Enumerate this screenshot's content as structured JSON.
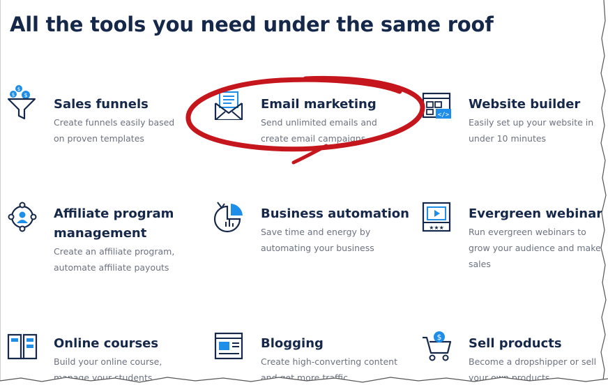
{
  "heading": "All the tools you need under the same roof",
  "features": [
    {
      "id": "sales-funnels",
      "icon": "funnel-icon",
      "title": "Sales funnels",
      "desc": "Create funnels easily based on proven templates"
    },
    {
      "id": "email-marketing",
      "icon": "email-newsletter-icon",
      "title": "Email marketing",
      "desc": "Send unlimited emails and create email campaigns"
    },
    {
      "id": "website-builder",
      "icon": "website-code-icon",
      "title": "Website builder",
      "desc": "Easily set up your website in under 10 minutes"
    },
    {
      "id": "affiliate",
      "icon": "affiliate-network-icon",
      "title_line1": "Affiliate program",
      "title_line2": "management",
      "desc": "Create an affiliate program, automate affiliate payouts"
    },
    {
      "id": "business-automation",
      "icon": "automation-chart-icon",
      "title": "Business automation",
      "desc": "Save time and energy by automating your business"
    },
    {
      "id": "evergreen-webinars",
      "icon": "webinar-play-icon",
      "title": "Evergreen webinars",
      "desc": "Run evergreen webinars to grow your audience and make sales"
    },
    {
      "id": "online-courses",
      "icon": "open-book-icon",
      "title": "Online courses",
      "desc": "Build your online course, manage your students"
    },
    {
      "id": "blogging",
      "icon": "blog-article-icon",
      "title": "Blogging",
      "desc": "Create high-converting content and get more traffic"
    },
    {
      "id": "sell-products",
      "icon": "shopping-cart-icon",
      "title": "Sell products",
      "desc": "Become a dropshipper or sell your own products"
    }
  ],
  "colors": {
    "heading": "#16284a",
    "accent": "#1f8ee8",
    "text": "#6b7280",
    "annotation": "#c4161c"
  }
}
